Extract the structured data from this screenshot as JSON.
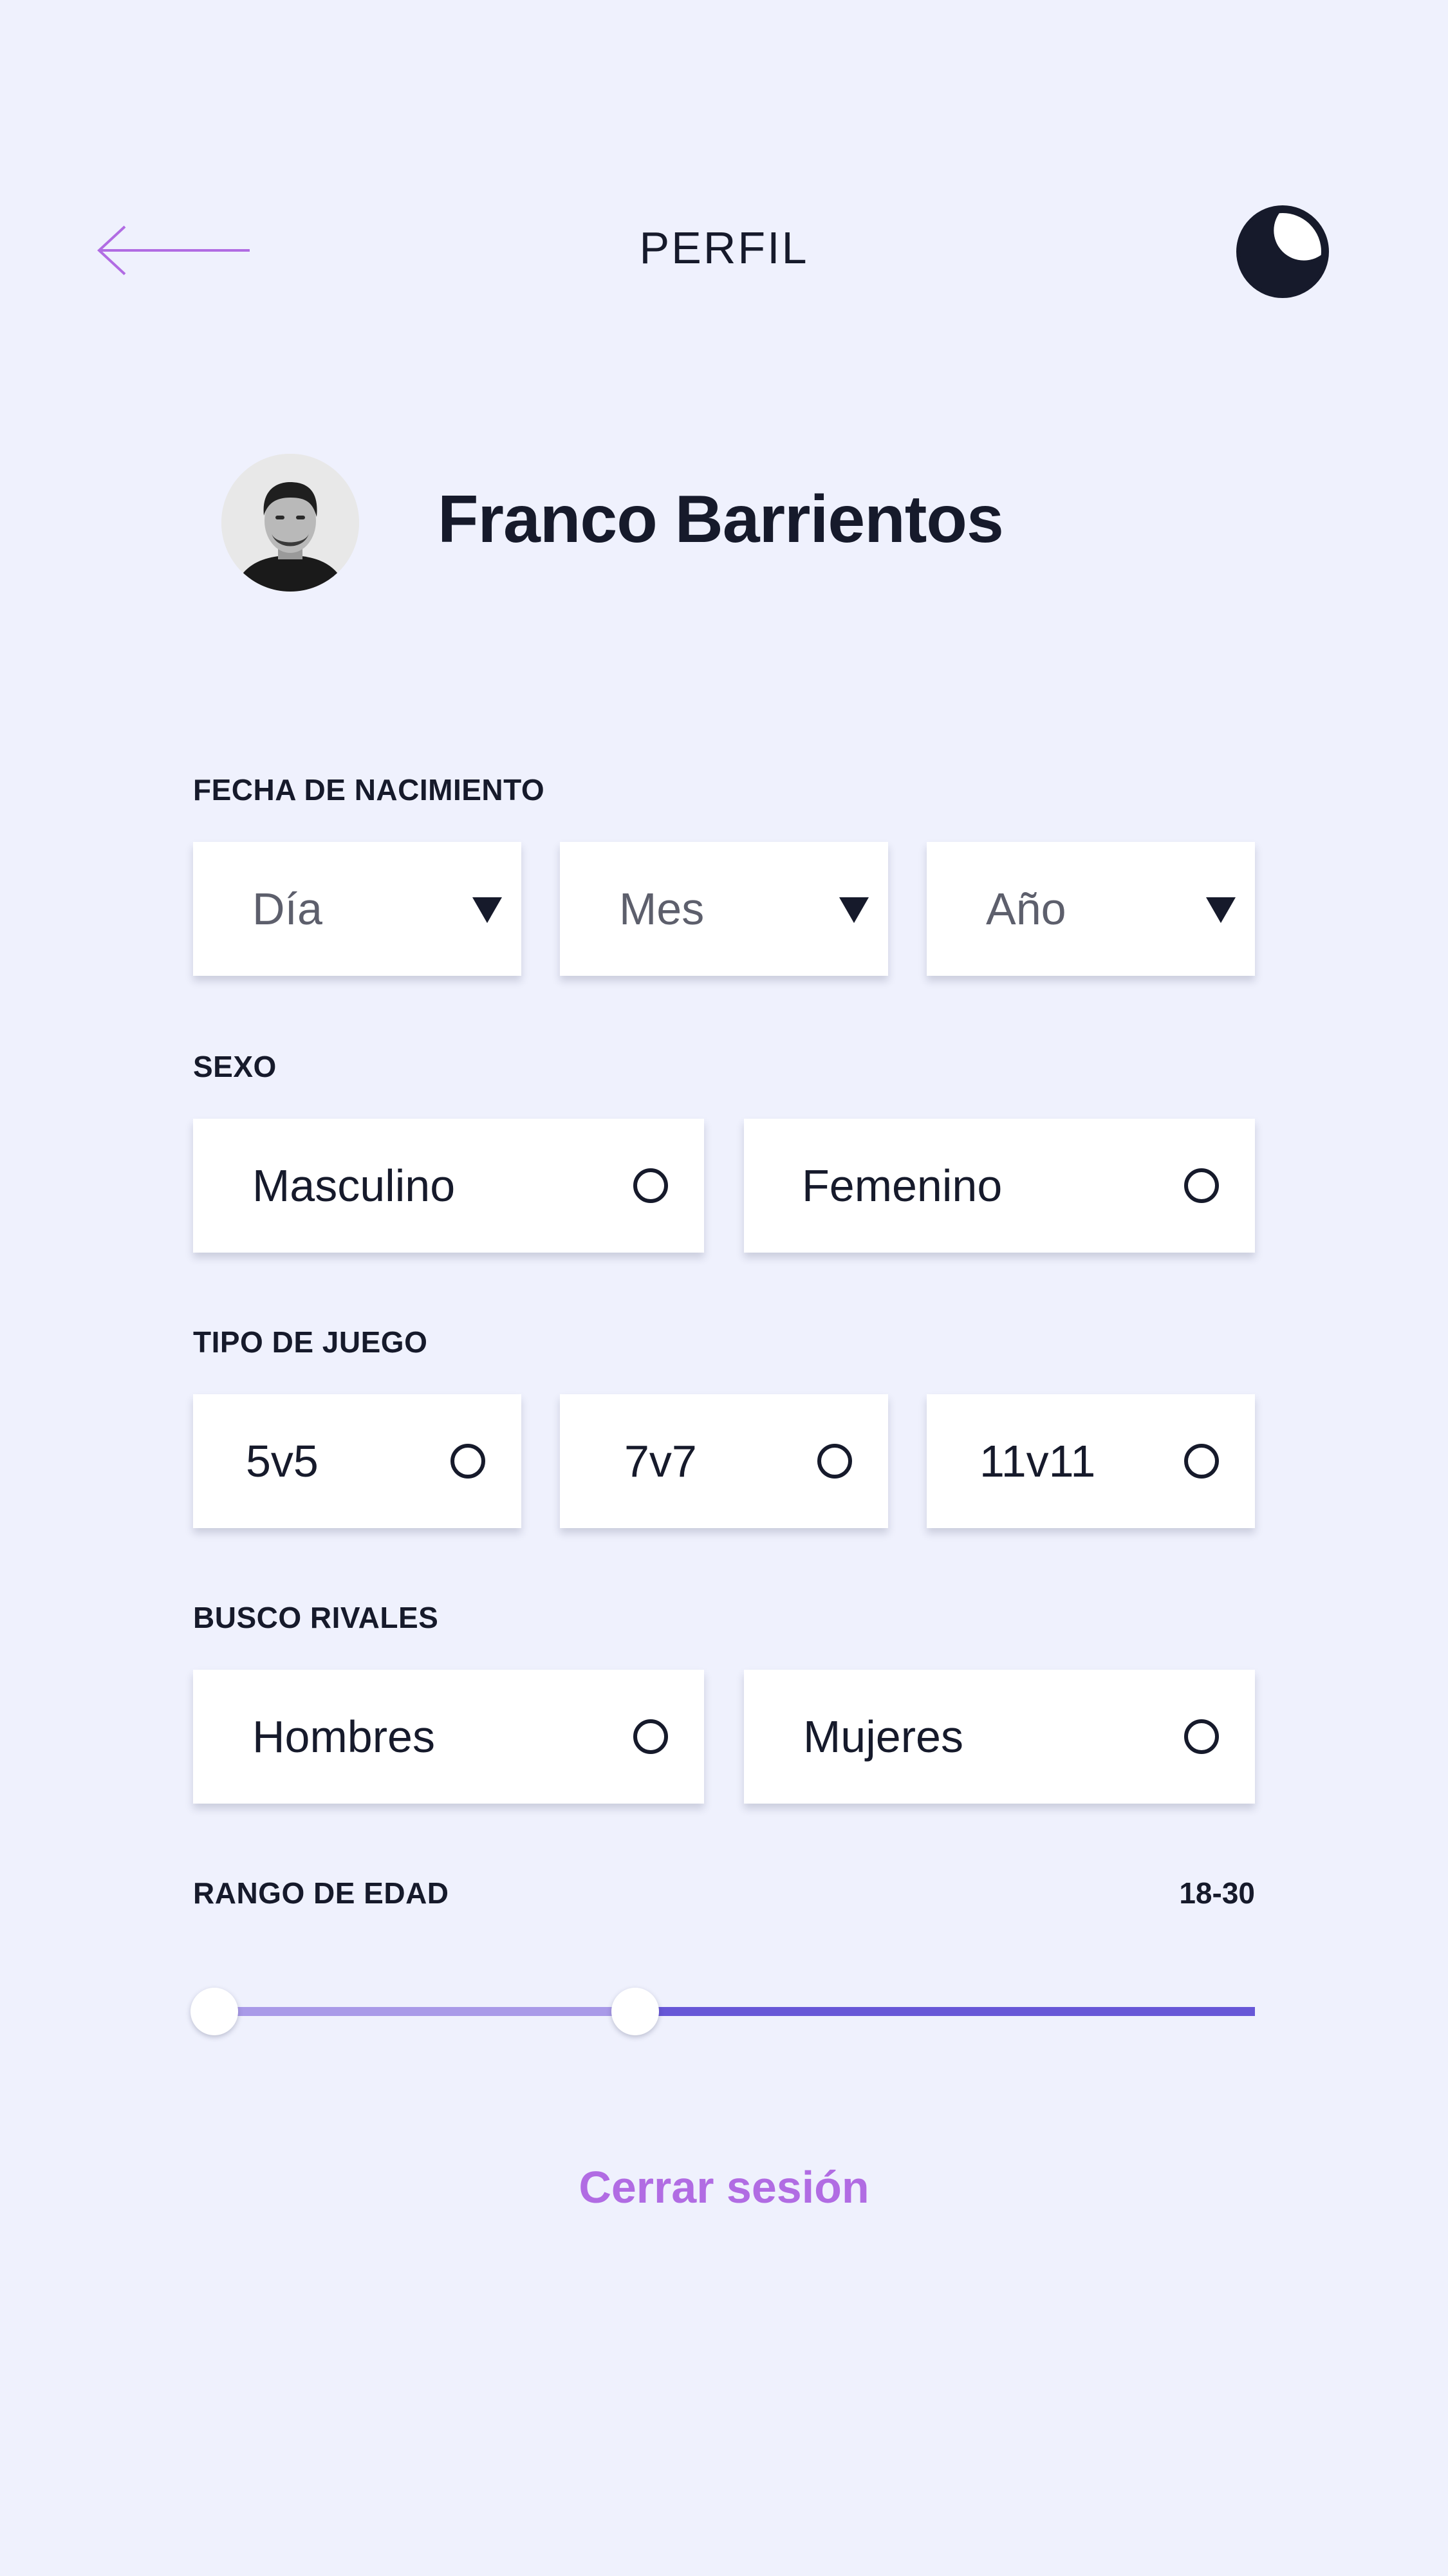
{
  "header": {
    "title": "PERFIL",
    "back_icon": "arrow-left-icon",
    "theme_icon": "moon-icon"
  },
  "profile": {
    "name": "Franco Barrientos",
    "avatar_icon": "avatar"
  },
  "birthdate": {
    "label": "FECHA DE NACIMIENTO",
    "day_placeholder": "Día",
    "month_placeholder": "Mes",
    "year_placeholder": "Año"
  },
  "sex": {
    "label": "SEXO",
    "options": [
      "Masculino",
      "Femenino"
    ]
  },
  "game_type": {
    "label": "TIPO DE JUEGO",
    "options": [
      "5v5",
      "7v7",
      "11v11"
    ]
  },
  "rivals": {
    "label": "BUSCO RIVALES",
    "options": [
      "Hombres",
      "Mujeres"
    ]
  },
  "age_range": {
    "label": "RANGO DE EDAD",
    "value": "18-30",
    "min": 18,
    "max": 30
  },
  "logout_label": "Cerrar sesión",
  "colors": {
    "background": "#eff1fd",
    "text": "#161a2b",
    "accent": "#b16ce3",
    "slider_light": "#a99ae8",
    "slider_dark": "#6757d7"
  }
}
